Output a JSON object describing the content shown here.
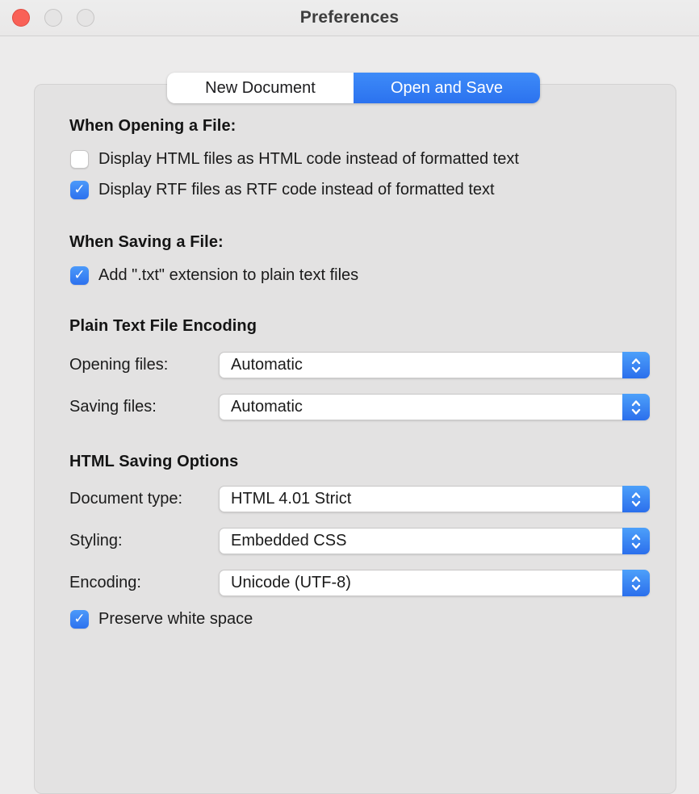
{
  "window": {
    "title": "Preferences"
  },
  "tabs": {
    "new_document": {
      "label": "New Document",
      "selected": false
    },
    "open_and_save": {
      "label": "Open and Save",
      "selected": true
    }
  },
  "opening_section": {
    "heading": "When Opening a File:",
    "checkbox_html": {
      "label": "Display HTML files as HTML code instead of formatted text",
      "checked": false
    },
    "checkbox_rtf": {
      "label": "Display RTF files as RTF code instead of formatted text",
      "checked": true
    }
  },
  "saving_section": {
    "heading": "When Saving a File:",
    "checkbox_txt": {
      "label": "Add \".txt\" extension to plain text files",
      "checked": true
    }
  },
  "plain_text_encoding_section": {
    "heading": "Plain Text File Encoding",
    "opening_files": {
      "label": "Opening files:",
      "value": "Automatic"
    },
    "saving_files": {
      "label": "Saving files:",
      "value": "Automatic"
    }
  },
  "html_saving_section": {
    "heading": "HTML Saving Options",
    "document_type": {
      "label": "Document type:",
      "value": "HTML 4.01 Strict"
    },
    "styling": {
      "label": "Styling:",
      "value": "Embedded CSS"
    },
    "encoding": {
      "label": "Encoding:",
      "value": "Unicode (UTF-8)"
    },
    "checkbox_preserve": {
      "label": "Preserve white space",
      "checked": true
    }
  },
  "colors": {
    "accent_blue": "#2E7CF6",
    "panel_gray": "#E3E2E2",
    "window_gray": "#ECEBEB",
    "close_button_red": "#F96157"
  },
  "glyphs": {
    "checkmark": "✓"
  }
}
